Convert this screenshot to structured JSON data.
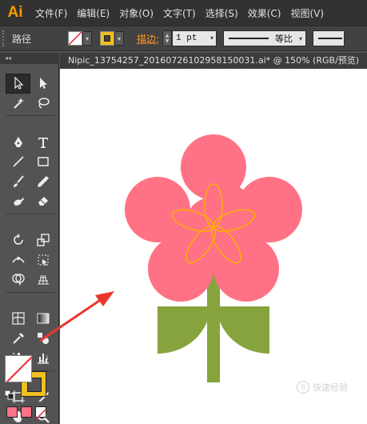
{
  "app": {
    "logo": "Ai"
  },
  "menu": [
    "文件(F)",
    "编辑(E)",
    "对象(O)",
    "文字(T)",
    "选择(S)",
    "效果(C)",
    "视图(V)"
  ],
  "control": {
    "selection_label": "路径",
    "stroke_label": "描边:",
    "stroke_value": "1 pt",
    "profile_label": "等比"
  },
  "document": {
    "tab_title": "Nipic_13754257_20160726102958150031.ai* @ 150% (RGB/预览)"
  },
  "tools": [
    "selection-icon",
    "direct-selection-icon",
    "magic-wand-icon",
    "lasso-icon",
    "pen-icon",
    "type-icon",
    "line-segment-icon",
    "rectangle-icon",
    "paintbrush-icon",
    "pencil-icon",
    "blob-brush-icon",
    "eraser-icon",
    "rotate-icon",
    "scale-icon",
    "width-icon",
    "free-transform-icon",
    "shape-builder-icon",
    "perspective-grid-icon",
    "mesh-icon",
    "gradient-icon",
    "eyedropper-icon",
    "blend-icon",
    "symbol-sprayer-icon",
    "column-graph-icon",
    "artboard-icon",
    "slice-icon",
    "hand-icon",
    "zoom-icon"
  ],
  "colors": {
    "petal": "#ff7285",
    "petal_outline": "#ffb000",
    "stem": "#86a33e",
    "stroke_swatch": "#f0c020",
    "arrow": "#e8372d",
    "accent": "#ff9a00"
  },
  "watermark": {
    "text": "快速经验",
    "badge": "S"
  }
}
